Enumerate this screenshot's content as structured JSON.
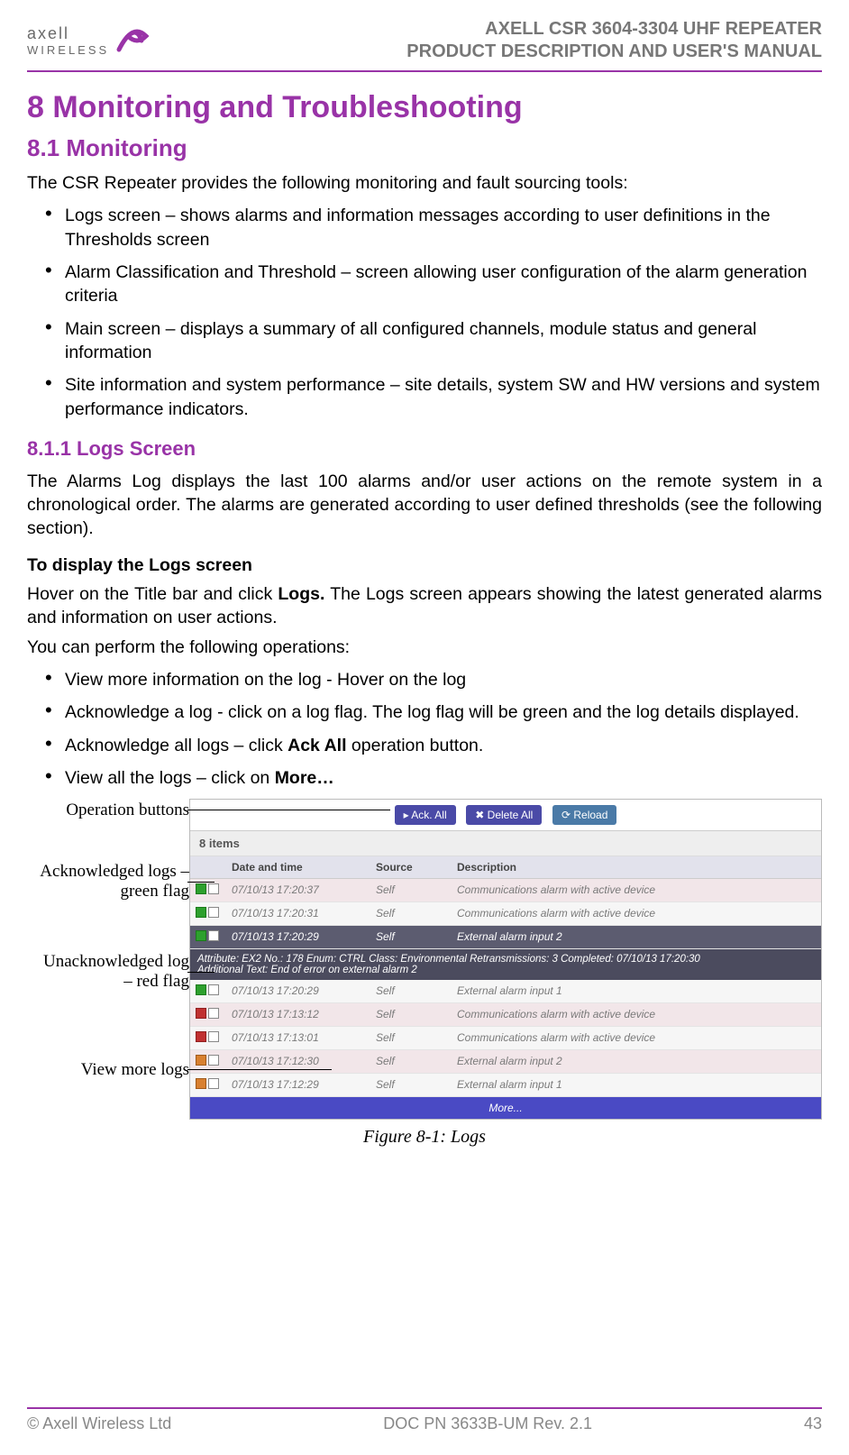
{
  "header": {
    "logo_brand": "axell",
    "logo_sub": "WIRELESS",
    "title_line1": "AXELL CSR 3604-3304 UHF REPEATER",
    "title_line2": "PRODUCT DESCRIPTION AND USER'S MANUAL"
  },
  "s8": {
    "heading": "8  Monitoring and Troubleshooting",
    "s81": {
      "heading": "8.1 Monitoring",
      "intro": "The CSR Repeater provides the following monitoring and fault sourcing tools:",
      "bullets": [
        "Logs screen – shows alarms and information messages according to user definitions in the Thresholds screen",
        "Alarm Classification and Threshold – screen allowing user configuration of the alarm generation criteria",
        "Main screen – displays a summary of all configured channels, module status and general information",
        "Site information and system performance – site details, system SW and HW versions and system performance indicators."
      ]
    },
    "s811": {
      "heading": "8.1.1 Logs Screen",
      "p1": "The Alarms Log displays the last 100 alarms and/or user actions on the remote system in a chronological order. The alarms are generated according to user defined thresholds (see the following section).",
      "sub": "To display the Logs screen",
      "p2a": "Hover on the Title bar and click ",
      "p2_bold": "Logs.",
      "p2b": " The Logs screen appears showing the latest generated alarms and information on user actions.",
      "p3": "You can perform the following operations:",
      "bullets": [
        "View more information on the log - Hover on the log",
        "Acknowledge a log - click on a log flag. The log flag will be green and the log details displayed.",
        "Acknowledge all logs – click Ack All operation button.",
        "View all the logs – click on More…"
      ],
      "bullet3_pre": "Acknowledge all logs – click ",
      "bullet3_bold": "Ack All",
      "bullet3_post": " operation button.",
      "bullet4_pre": "View all the logs – click on ",
      "bullet4_bold": "More…"
    }
  },
  "callouts": {
    "c1": "Operation buttons",
    "c2": "Acknowledged logs – green flag",
    "c3": "Unacknowledged log – red flag",
    "c4": "View more logs"
  },
  "screenshot": {
    "buttons": {
      "ack_all": "Ack. All",
      "delete_all": "Delete All",
      "reload": "Reload"
    },
    "count": "8 items",
    "columns": {
      "date": "Date and time",
      "source": "Source",
      "desc": "Description"
    },
    "rows": [
      {
        "flag": "green",
        "date": "07/10/13 17:20:37",
        "src": "Self",
        "desc": "Communications alarm with active device"
      },
      {
        "flag": "green",
        "date": "07/10/13 17:20:31",
        "src": "Self",
        "desc": "Communications alarm with active device"
      },
      {
        "flag": "green",
        "date": "07/10/13 17:20:29",
        "src": "Self",
        "desc": "External alarm input 2",
        "selected": true
      },
      {
        "flag": "green",
        "date": "07/10/13 17:20:29",
        "src": "Self",
        "desc": "External alarm input 1"
      },
      {
        "flag": "red",
        "date": "07/10/13 17:13:12",
        "src": "Self",
        "desc": "Communications alarm with active device"
      },
      {
        "flag": "red",
        "date": "07/10/13 17:13:01",
        "src": "Self",
        "desc": "Communications alarm with active device"
      },
      {
        "flag": "orange",
        "date": "07/10/13 17:12:30",
        "src": "Self",
        "desc": "External alarm input 2"
      },
      {
        "flag": "orange",
        "date": "07/10/13 17:12:29",
        "src": "Self",
        "desc": "External alarm input 1"
      }
    ],
    "attr_line1": "Attribute: EX2    No.: 178    Enum: CTRL    Class: Environmental    Retransmissions: 3    Completed: 07/10/13 17:20:30",
    "attr_line2": "Additional Text: End of error on external alarm 2",
    "more": "More..."
  },
  "caption": "Figure 8-1:  Logs",
  "footer": {
    "left": "© Axell Wireless Ltd",
    "center": "DOC PN 3633B-UM Rev. 2.1",
    "right": "43"
  }
}
